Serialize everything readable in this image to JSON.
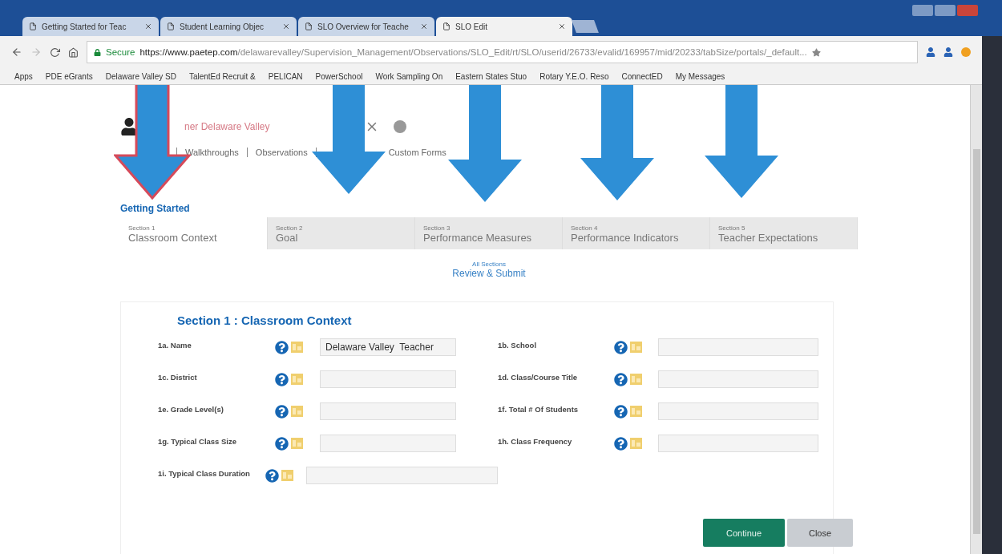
{
  "browser": {
    "tabs": [
      {
        "label": "Getting Started for Teac",
        "selected": false
      },
      {
        "label": "Student Learning Objec",
        "selected": false
      },
      {
        "label": "SLO Overview for Teache",
        "selected": false
      },
      {
        "label": "SLO Edit",
        "selected": true
      }
    ],
    "secure_label": "Secure",
    "url_host": "https://www.paetep.com",
    "url_path": "/delawarevalley/Supervision_Management/Observations/SLO_Edit/rt/SLO/userid/26733/evalid/169957/mid/20233/tabSize/portals/_default...",
    "bookmarks": [
      "Apps",
      "PDE eGrants",
      "Delaware Valley SD",
      "TalentEd Recruit &",
      "PELICAN",
      "PowerSchool",
      "Work Sampling On",
      "Eastern States Stuo",
      "Rotary Y.E.O. Reso",
      "ConnectED",
      "My Messages"
    ]
  },
  "header": {
    "user_name": "ner Delaware Valley",
    "nav": [
      "Walkthroughs",
      "Observations",
      "Custom Forms"
    ]
  },
  "steps_title": "Getting Started",
  "steps": [
    {
      "section": "Section 1",
      "title": "Classroom Context",
      "selected": true
    },
    {
      "section": "Section 2",
      "title": "Goal",
      "selected": false
    },
    {
      "section": "Section 3",
      "title": "Performance Measures",
      "selected": false
    },
    {
      "section": "Section 4",
      "title": "Performance Indicators",
      "selected": false
    },
    {
      "section": "Section 5",
      "title": "Teacher Expectations",
      "selected": false
    }
  ],
  "review": {
    "caption": "All Sections",
    "title": "Review & Submit"
  },
  "form": {
    "title": "Section 1 : Classroom Context",
    "fields": [
      {
        "label": "1a. Name",
        "value": "Delaware Valley  Teacher",
        "wide": false
      },
      {
        "label": "1b. School",
        "wide": false
      },
      {
        "label": "1c. District",
        "wide": false
      },
      {
        "label": "1d. Class/Course Title",
        "wide": false
      },
      {
        "label": "1e. Grade Level(s)",
        "wide": false
      },
      {
        "label": "1f. Total # Of Students",
        "wide": false
      },
      {
        "label": "1g. Typical Class Size",
        "wide": false
      },
      {
        "label": "1h. Class Frequency",
        "wide": false
      },
      {
        "label": "1i. Typical Class Duration",
        "wide": true
      }
    ]
  },
  "buttons": [
    {
      "label": "Continue",
      "kind": "primary"
    },
    {
      "label": "Close",
      "kind": "secondary"
    }
  ],
  "annotations": [
    {
      "kind": "arrow",
      "outlined": true
    },
    {
      "kind": "arrow",
      "outlined": false
    },
    {
      "kind": "arrow",
      "outlined": false
    },
    {
      "kind": "arrow",
      "outlined": false
    },
    {
      "kind": "arrow",
      "outlined": false
    }
  ]
}
